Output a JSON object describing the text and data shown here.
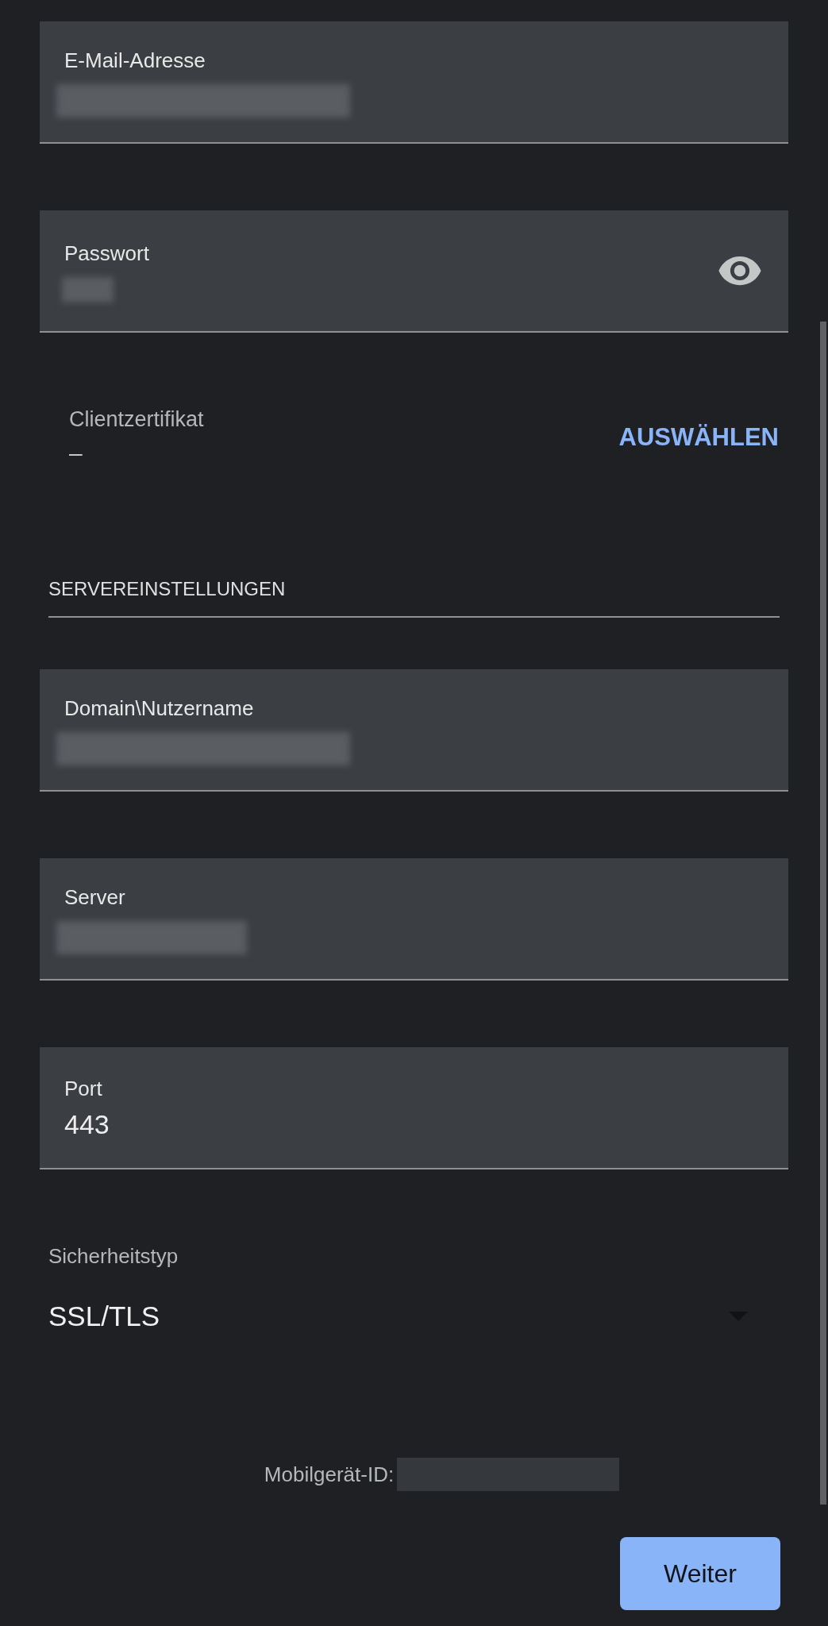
{
  "account_fields": [
    {
      "kind": "text",
      "label": "E-Mail-Adresse",
      "redacted": true
    },
    {
      "kind": "password",
      "label": "Passwort",
      "redacted": true
    }
  ],
  "client_certificate": {
    "label": "Clientzertifikat",
    "value": "–",
    "button": "AUSWÄHLEN"
  },
  "section_heading": "SERVEREINSTELLUNGEN",
  "server_fields": [
    {
      "label": "Domain\\Nutzername",
      "redacted": true
    },
    {
      "label": "Server",
      "redacted": true,
      "short": true
    },
    {
      "label": "Port",
      "value": "443"
    }
  ],
  "security_type": {
    "label": "Sicherheitstyp",
    "value": "SSL/TLS"
  },
  "device_id": {
    "label": "Mobilgerät-ID:",
    "redacted": true
  },
  "next_button": "Weiter"
}
